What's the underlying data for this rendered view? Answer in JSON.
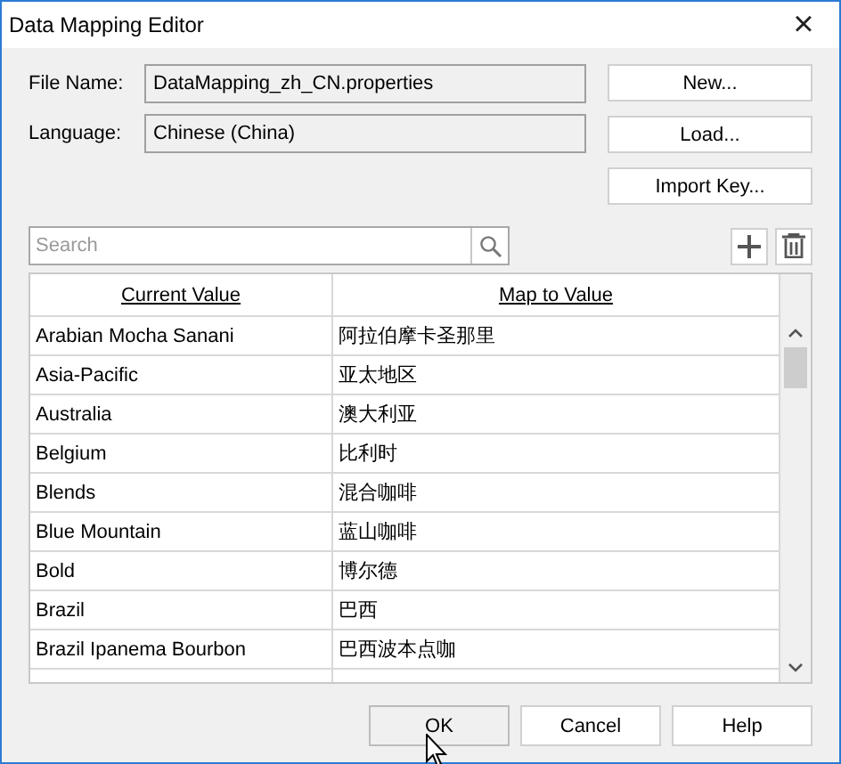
{
  "window": {
    "title": "Data Mapping Editor",
    "close": "×"
  },
  "fields": [
    {
      "label": "File Name:",
      "value": "DataMapping_zh_CN.properties"
    },
    {
      "label": "Language:",
      "value": "Chinese (China)"
    }
  ],
  "side_buttons": [
    "New...",
    "Load...",
    "Import Key..."
  ],
  "search": {
    "placeholder": "Search"
  },
  "table": {
    "columns": [
      "Current Value",
      "Map to Value"
    ],
    "rows": [
      [
        "Arabian Mocha Sanani",
        "阿拉伯摩卡圣那里"
      ],
      [
        "Asia-Pacific",
        "亚太地区"
      ],
      [
        "Australia",
        "澳大利亚"
      ],
      [
        "Belgium",
        "比利时"
      ],
      [
        "Blends",
        "混合咖啡"
      ],
      [
        "Blue Mountain",
        "蓝山咖啡"
      ],
      [
        "Bold",
        "博尔德"
      ],
      [
        "Brazil",
        "巴西"
      ],
      [
        "Brazil Ipanema Bourbon",
        "巴西波本点咖"
      ]
    ]
  },
  "buttons": [
    {
      "label": "OK",
      "selected": true
    },
    {
      "label": "Cancel",
      "selected": false
    },
    {
      "label": "Help",
      "selected": false
    }
  ]
}
